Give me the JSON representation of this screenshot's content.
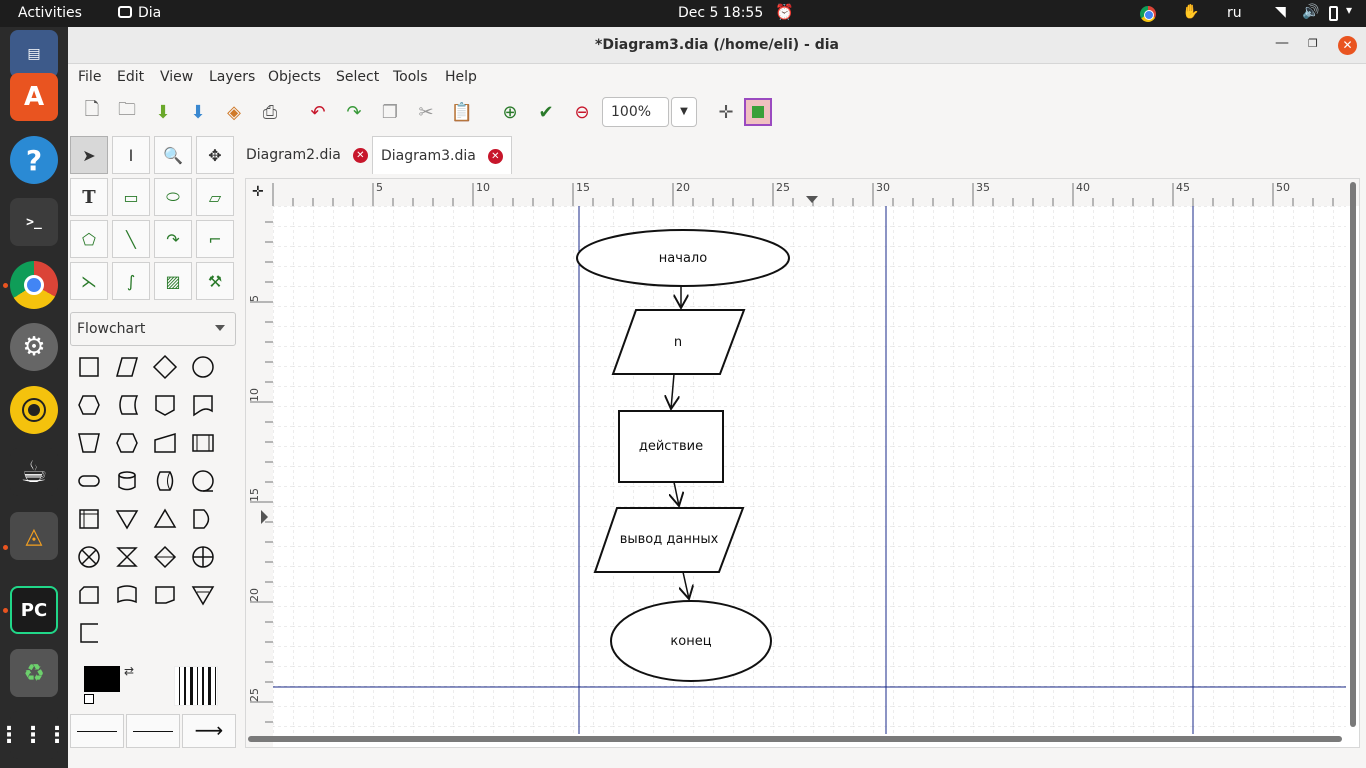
{
  "topbar": {
    "activities": "Activities",
    "app_name": "Dia",
    "clock": "Dec 5  18:55",
    "lang": "ru"
  },
  "window": {
    "title": "*Diagram3.dia (/home/eli) - dia"
  },
  "menu": [
    "File",
    "Edit",
    "View",
    "Layers",
    "Objects",
    "Select",
    "Tools",
    "Help"
  ],
  "toolbar": {
    "zoom": "100%"
  },
  "sheet": {
    "selected": "Flowchart"
  },
  "tabs": [
    {
      "label": "Diagram2.dia",
      "active": false
    },
    {
      "label": "Diagram3.dia",
      "active": true
    }
  ],
  "ruler": {
    "h_labels": [
      "5",
      "10",
      "15",
      "20",
      "25",
      "30",
      "35",
      "40",
      "45",
      "50"
    ],
    "v_labels": [
      "5",
      "10",
      "15",
      "20",
      "25"
    ]
  },
  "diagram": {
    "nodes": {
      "start": "начало",
      "input": "n",
      "process": "действие",
      "output": "вывод данных",
      "end": "конец"
    }
  },
  "colors": {
    "accent": "#e95420",
    "guide": "#1a2a8a",
    "grid": "#dcdcdc"
  }
}
